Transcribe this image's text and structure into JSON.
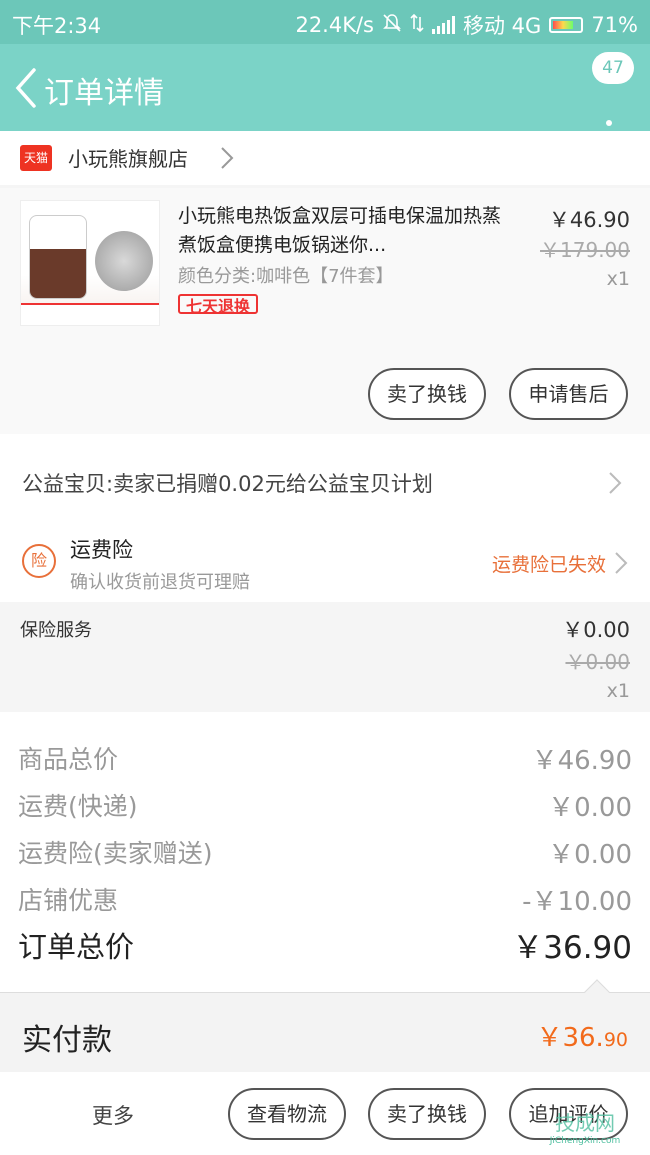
{
  "status_bar": {
    "time": "下午2:34",
    "speed": "22.4K/s",
    "carrier": "移动 4G",
    "battery": "71%"
  },
  "nav": {
    "title": "订单详情",
    "badge_count": "47"
  },
  "store": {
    "logo_text": "天猫",
    "name": "小玩熊旗舰店"
  },
  "product": {
    "title": "小玩熊电热饭盒双层可插电保温加热蒸煮饭盒便携电饭锅迷你...",
    "sku": "颜色分类:咖啡色【7件套】",
    "tag": "七天退换",
    "price": "￥46.90",
    "original_price": "￥179.00",
    "quantity": "x1",
    "buttons": {
      "sell": "卖了换钱",
      "after_sale": "申请售后"
    }
  },
  "charity": {
    "text": "公益宝贝:卖家已捐赠0.02元给公益宝贝计划"
  },
  "shipping_insurance": {
    "icon_text": "险",
    "title": "运费险",
    "subtitle": "确认收货前退货可理赔",
    "status": "运费险已失效"
  },
  "insurance_service": {
    "name": "保险服务",
    "price": "￥0.00",
    "original_price": "￥0.00",
    "quantity": "x1"
  },
  "summary": {
    "rows": [
      {
        "label": "商品总价",
        "value": "￥46.90"
      },
      {
        "label": "运费(快递)",
        "value": "￥0.00"
      },
      {
        "label": "运费险(卖家赠送)",
        "value": "￥0.00"
      },
      {
        "label": "店铺优惠",
        "value": "-￥10.00"
      }
    ],
    "total_label": "订单总价",
    "total_value": "￥36.90"
  },
  "payment": {
    "label": "实付款",
    "value_main": "￥36.",
    "value_cents": "90"
  },
  "bottom_bar": {
    "more": "更多",
    "logistics": "查看物流",
    "sell": "卖了换钱",
    "review": "追加评价"
  },
  "watermark": {
    "cn": "技成网",
    "en": "JiChengXin.com"
  },
  "colors": {
    "accent": "#7bd3c7",
    "status_bar": "#6cc7b9",
    "orange": "#f26a1b",
    "red": "#e33333"
  }
}
